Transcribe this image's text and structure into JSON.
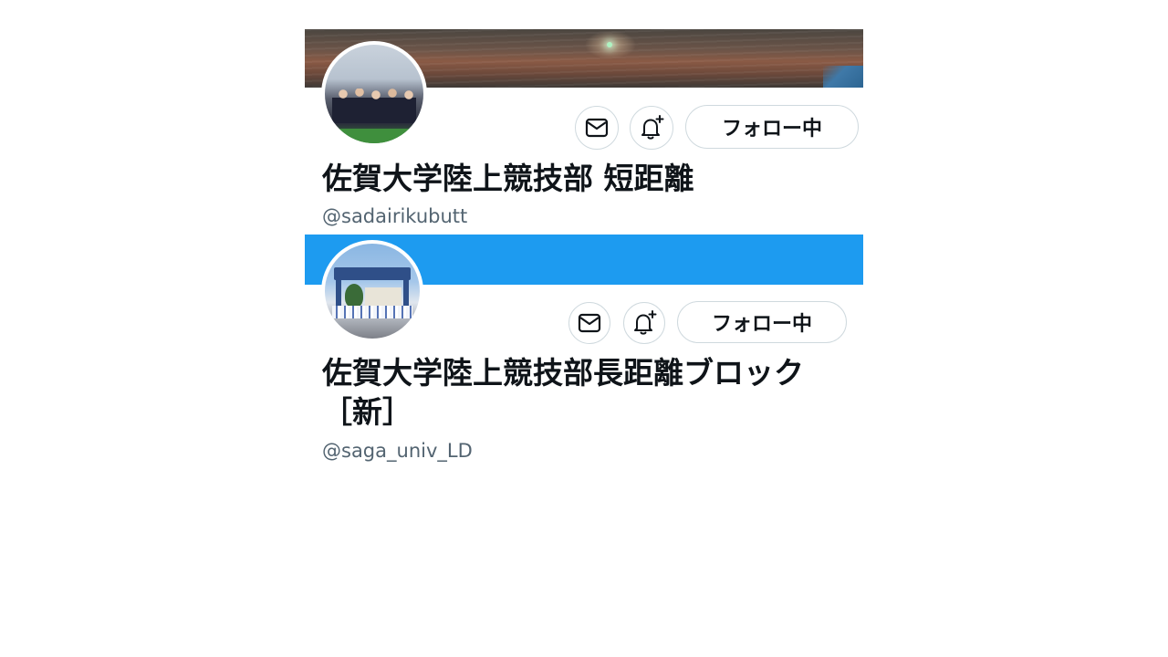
{
  "profiles": [
    {
      "display_name": "佐賀大学陸上競技部 短距離",
      "handle": "@sadairikubutt",
      "follow_label": "フォロー中",
      "banner_color": "#6b5448",
      "icons": {
        "message": "mail-icon",
        "notify": "bell-plus-icon"
      }
    },
    {
      "display_name": "佐賀大学陸上競技部長距離ブロック［新］",
      "handle": "@saga_univ_LD",
      "follow_label": "フォロー中",
      "banner_color": "#1d9bf0",
      "icons": {
        "message": "mail-icon",
        "notify": "bell-plus-icon"
      }
    }
  ],
  "colors": {
    "text_primary": "#0f1419",
    "text_secondary": "#536471",
    "button_border": "#cfd9de"
  }
}
